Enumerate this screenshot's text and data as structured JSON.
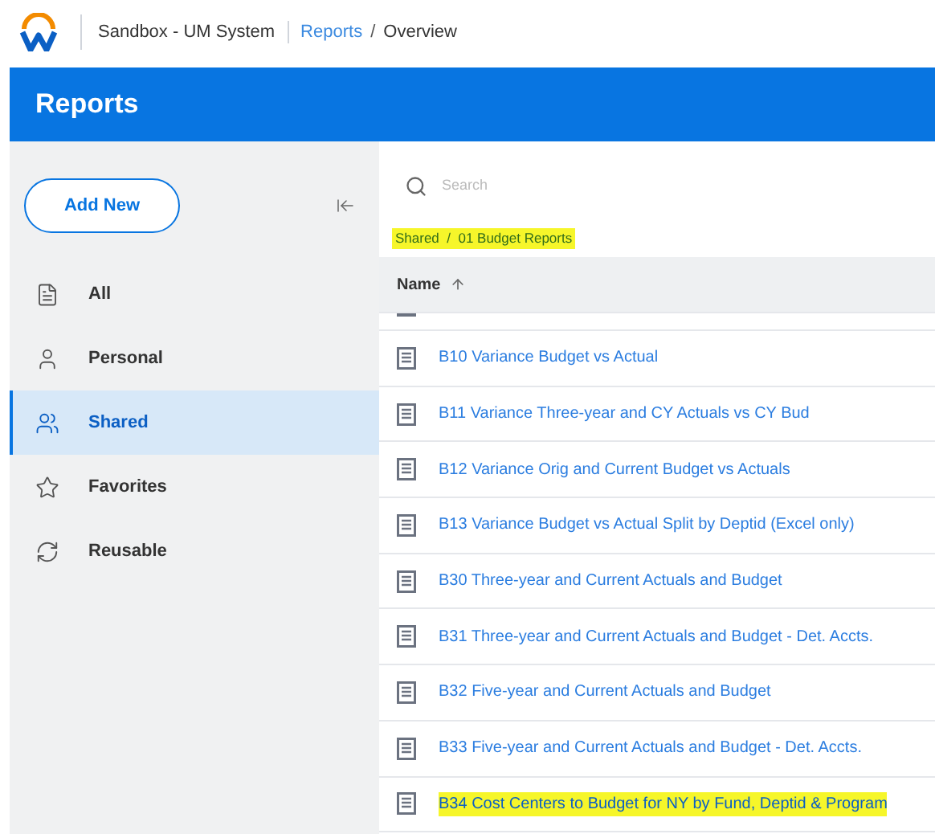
{
  "header": {
    "tenant": "Sandbox - UM System",
    "separator": "/",
    "breadcrumb": [
      {
        "label": "Reports",
        "link": true
      },
      {
        "label": "Overview",
        "link": false
      }
    ]
  },
  "banner": {
    "title": "Reports"
  },
  "sidebar": {
    "add_button": "Add New",
    "items": [
      {
        "label": "All",
        "kind": "doc",
        "selected": false
      },
      {
        "label": "Personal",
        "kind": "person",
        "selected": false
      },
      {
        "label": "Shared",
        "kind": "shared",
        "selected": true
      },
      {
        "label": "Favorites",
        "kind": "star",
        "selected": false
      },
      {
        "label": "Reusable",
        "kind": "refresh",
        "selected": false
      }
    ]
  },
  "search": {
    "placeholder": "Search"
  },
  "path": {
    "highlighted": true,
    "parts": [
      "Shared",
      "/",
      "01 Budget Reports"
    ]
  },
  "table": {
    "columns": [
      {
        "label": "Name"
      }
    ],
    "rows": [
      {
        "name": "B10 Variance Budget vs Actual",
        "highlighted": false
      },
      {
        "name": "B11 Variance Three-year and CY Actuals vs CY Bud",
        "highlighted": false
      },
      {
        "name": "B12 Variance Orig and Current Budget vs Actuals",
        "highlighted": false
      },
      {
        "name": "B13 Variance Budget vs Actual Split by Deptid (Excel only)",
        "highlighted": false
      },
      {
        "name": "B30 Three-year and Current Actuals and Budget",
        "highlighted": false
      },
      {
        "name": "B31 Three-year and Current Actuals and Budget - Det. Accts.",
        "highlighted": false
      },
      {
        "name": "B32 Five-year and Current Actuals and Budget",
        "highlighted": false
      },
      {
        "name": "B33 Five-year and Current Actuals and Budget - Det. Accts.",
        "highlighted": false
      },
      {
        "name": "B34 Cost Centers to Budget for NY by Fund, Deptid & Program",
        "highlighted": true
      }
    ]
  }
}
